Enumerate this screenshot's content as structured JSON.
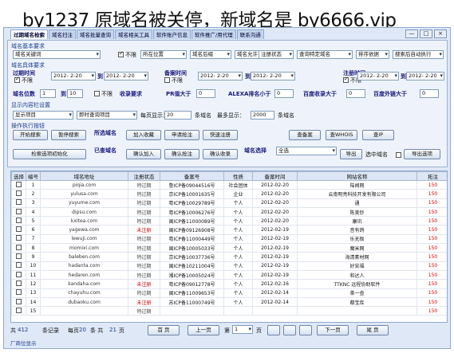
{
  "headline": "by1237 原域名被关停，新域名是 by6666.vip",
  "tabs": [
    "过期域名检索",
    "域名扫注",
    "域名批量查询",
    "域名相关工具",
    "软件账户信息",
    "软件推广/用代理",
    "联系沟通"
  ],
  "window_buttons": [
    "—",
    "□",
    "×"
  ],
  "search": {
    "section1": "域名基本要求",
    "keyword_select": "域名关键词",
    "checkbox_unlimited": "不限",
    "position_select": "所在位置",
    "suffix_select": "域名后缀",
    "allow_select": "域名允许",
    "reg_status_select": "注册状态",
    "query_special_select": "查询特定域名",
    "sort_select": "排序依据",
    "search_mode_select": "搜索后自动执行",
    "section2": "域名具体要求",
    "expire_label": "过期时间",
    "expire_from": "2012- 2-20",
    "expire_to": "2012- 2-20",
    "to": "到",
    "record_label": "备案时间",
    "record_from": "2012- 2-20",
    "record_to": "2012- 2-20",
    "regtime_label": "注册时间",
    "reg_from": "2012- 2-20",
    "reg_to": "2012- 2-20",
    "length_label": "域名位数",
    "len_min": "1",
    "len_max": "10",
    "included_label": "收录要求",
    "pr_label": "PR值大于",
    "pr_val": "0",
    "alexa_label": "ALEXA排名小于",
    "alexa_val": "0",
    "baidu_inc_label": "百度收录大于",
    "baidu_inc_val": "0",
    "baidu_out_label": "百度外链大于",
    "baidu_out_val": "0",
    "section3": "显示内容栏设置",
    "show_select": "显示项目",
    "instant_select": "即时查询项目",
    "per_page_label": "每页显示：",
    "per_page": "20",
    "per_page_unit": "条域名",
    "max_show_label": "最多显示：",
    "max_show": "2000",
    "max_unit": "条域名",
    "section4": "操作执行按钮",
    "btn_start": "开始搜索",
    "btn_pause": "暂停搜索",
    "already_checked": "所选域名",
    "btn_add_fav": "加入收藏",
    "btn_apply_domain": "申请抢注",
    "btn_quick_reg": "快速注册",
    "btn_check": "查备案",
    "btn_whois": "查WHOIS",
    "btn_ip": "查IP",
    "btn_search_beautify": "检索选项初始化",
    "already_selected": "已查域名",
    "btn_confirm_add": "确认加入",
    "btn_confirm_reg": "确认抢注",
    "btn_confirm_fav": "确认收录",
    "domain_select_label": "域名选择",
    "domain_select_all": "全选",
    "btn_export": "导出",
    "export_label": "选中域名",
    "btn_export_opt": "导出选项"
  },
  "table": {
    "headers": [
      "选择",
      "编号",
      "域名地址",
      "注册状态",
      "备案号",
      "性质",
      "备案时间",
      "网站名称",
      "拓注"
    ],
    "rows": [
      [
        "1",
        "piqia.com",
        "特过期",
        "鲁ICP备09044516号",
        "社会团体",
        "2012-02-20",
        "陆闻网",
        "150"
      ],
      [
        "2",
        "yulusa.com",
        "特过期",
        "京ICP备10001635号",
        "企业",
        "2012-02-20",
        "云南明亮科技开发有限公司",
        "150"
      ],
      [
        "3",
        "yuyume.com",
        "特过期",
        "粤ICP备10029789号",
        "个人",
        "2012-02-20",
        "通",
        "150"
      ],
      [
        "4",
        "dipsu.com",
        "特过期",
        "粤ICP备10006276号",
        "个人",
        "2012-02-20",
        "陈美钞",
        "150"
      ],
      [
        "5",
        "kxitea.com",
        "特过期",
        "闽ICP备11000089号",
        "个人",
        "2012-02-20",
        "康讯",
        "150"
      ],
      [
        "6",
        "yagewa.com",
        "未注册",
        "闽ICP备09126908号",
        "个人",
        "2012-02-19",
        "音有鸽",
        "150"
      ],
      [
        "7",
        "lewuji.com",
        "特过期",
        "粤ICP备11000449号",
        "个人",
        "2012-02-19",
        "乐无极",
        "150"
      ],
      [
        "8",
        "momixi.com",
        "特过期",
        "闽ICP备10005033号",
        "个人",
        "2012-02-19",
        "魔米网",
        "150"
      ],
      [
        "9",
        "baleben.com",
        "特过期",
        "京ICP备10037736号",
        "个人",
        "2012-02-19",
        "海清素材网",
        "150"
      ],
      [
        "10",
        "hadanta.com",
        "特过期",
        "闽ICP备10211004号",
        "个人",
        "2012-02-19",
        "好安福",
        "150"
      ],
      [
        "11",
        "hedaren.com",
        "特过期",
        "湘ICP备10005024号",
        "个人",
        "2012-02-19",
        "和达人",
        "150"
      ],
      [
        "12",
        "kandaha.com",
        "未注册",
        "粤ICP备09012778号",
        "个人",
        "2012-02-16",
        "TTKNC 远程协助软件",
        "150"
      ],
      [
        "13",
        "chayuhu.com",
        "特过期",
        "闽ICP备11009653号",
        "个人",
        "2012-02-14",
        "茶一壶",
        "150"
      ],
      [
        "14",
        "dubaoku.com",
        "未注册",
        "苏ICP备11000749号",
        "个人",
        "2012-02-14",
        "都宝库",
        "150"
      ],
      [
        "15",
        "",
        "特过期",
        "",
        "",
        "",
        "",
        "150"
      ]
    ]
  },
  "footer": {
    "total_label": "共",
    "total": "412",
    "items_label": "条记录",
    "per_label": "每页",
    "per": "20",
    "pages_label": "条  共",
    "pages": "21",
    "pages_unit": "页",
    "first": "首  页",
    "prev": "上一页",
    "page_prefix": "第",
    "page": "1",
    "page_suffix": "页",
    "next": "下一页",
    "last": "尾  页"
  },
  "status": "厂商位显示"
}
